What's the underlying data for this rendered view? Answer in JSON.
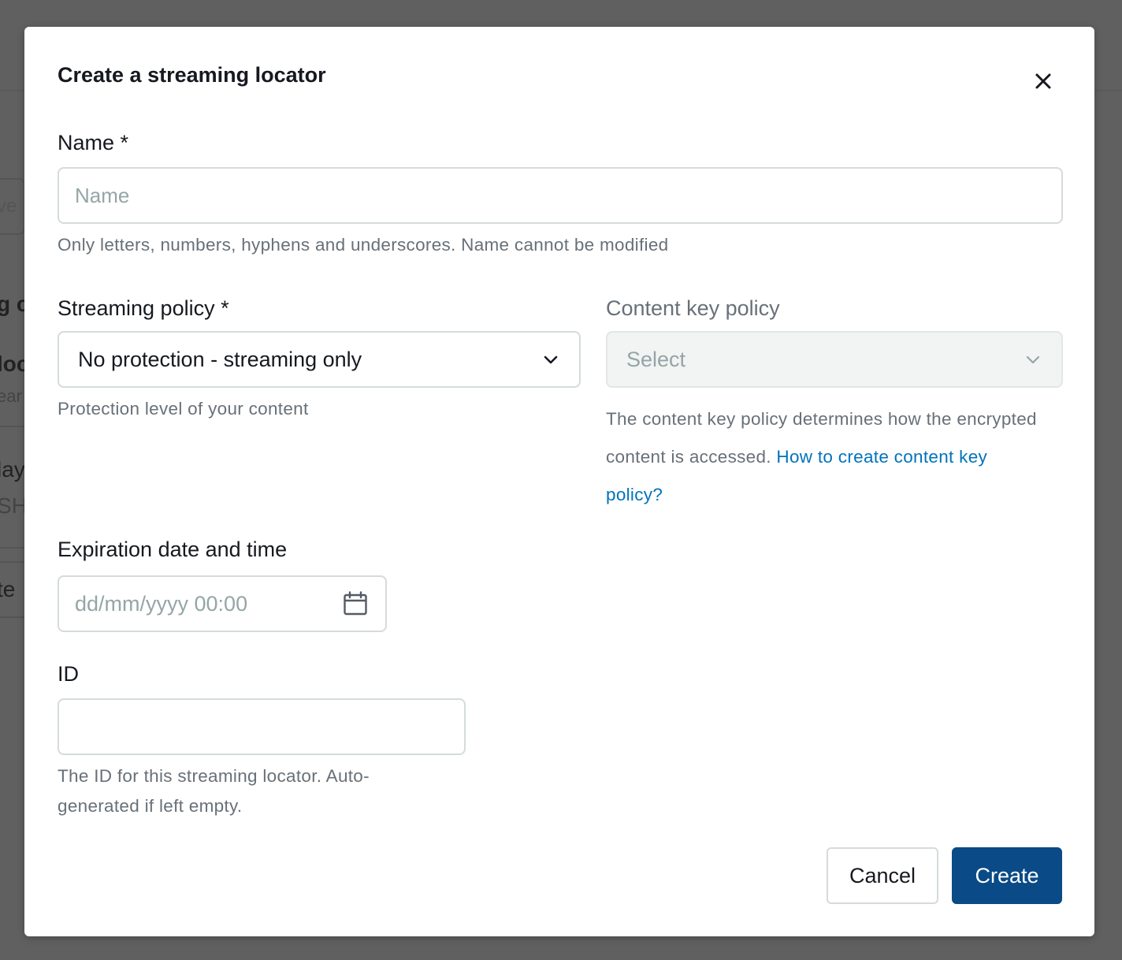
{
  "background": {
    "fragments": [
      "ve",
      "g c",
      "loc",
      "ear",
      "lay",
      "SH",
      "te"
    ]
  },
  "modal": {
    "title": "Create a streaming locator",
    "close_icon": "close-icon"
  },
  "name_field": {
    "label": "Name *",
    "placeholder": "Name",
    "value": "",
    "hint": "Only letters, numbers, hyphens and underscores. Name cannot be modified"
  },
  "streaming_policy": {
    "label": "Streaming policy *",
    "selected": "No protection - streaming only",
    "hint": "Protection level of your content",
    "icon": "chevron-down-icon"
  },
  "content_key_policy": {
    "label": "Content key policy",
    "selected": "Select",
    "disabled": true,
    "hint_prefix": "The content key policy determines how the encrypted content is accessed. ",
    "hint_link": "How to create content key policy?",
    "icon": "chevron-down-icon"
  },
  "expiration": {
    "label": "Expiration date and time",
    "placeholder": "dd/mm/yyyy 00:00",
    "icon": "calendar-icon"
  },
  "id_field": {
    "label": "ID",
    "value": "",
    "hint": "The ID for this streaming locator. Auto-generated if left empty."
  },
  "buttons": {
    "cancel": "Cancel",
    "create": "Create"
  },
  "colors": {
    "primary": "#0a4a86",
    "link": "#0073bb",
    "overlay": "#606060"
  }
}
